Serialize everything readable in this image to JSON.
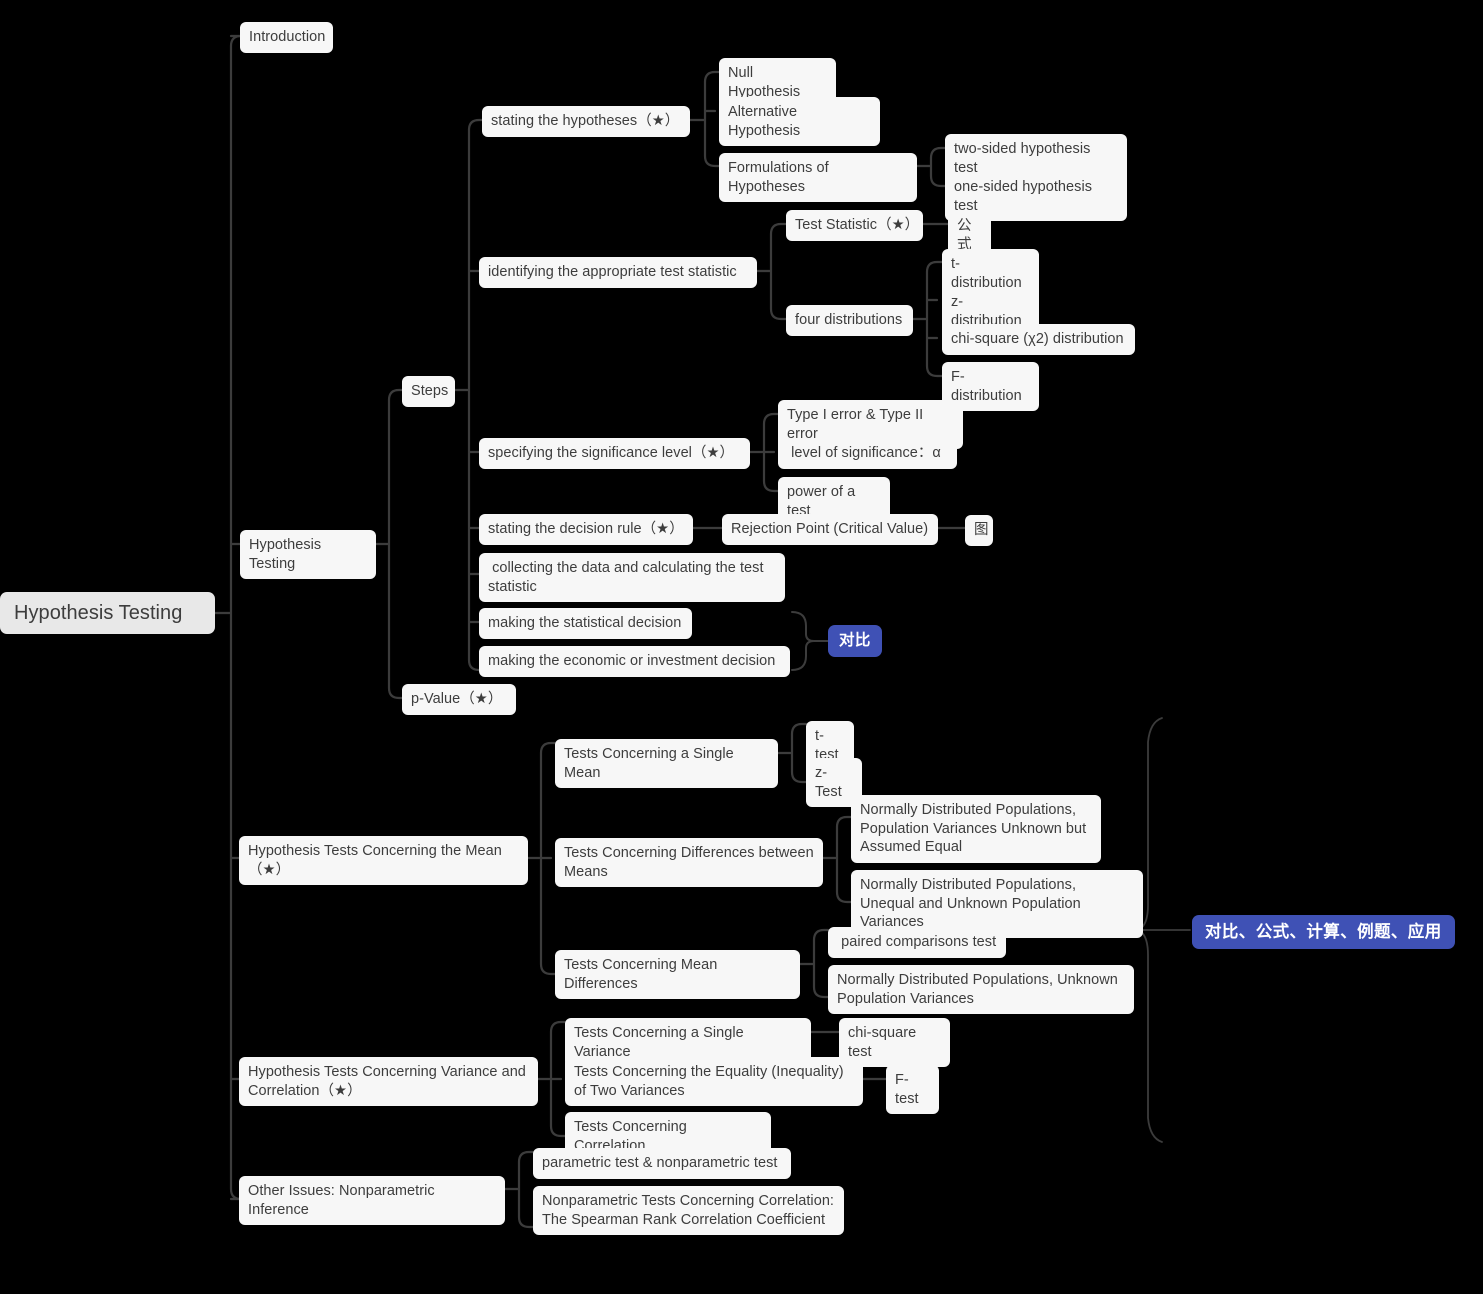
{
  "title": "Hypothesis Testing",
  "colors": {
    "background": "#000000",
    "node_fill": "#f7f7f7",
    "root_fill": "#e8e8e8",
    "node_text": "#3d3d3d",
    "link": "#3c3c3c",
    "badge_fill": "#3f51b5",
    "badge_text": "#ffffff"
  },
  "root": {
    "label": "Hypothesis Testing"
  },
  "nodes": {
    "introduction": "Introduction",
    "hypothesis_testing": "Hypothesis Testing",
    "steps": "Steps",
    "stating_hypotheses": "stating the hypotheses（★）",
    "null_hypothesis": "Null Hypothesis",
    "alternative_hypothesis": "Alternative Hypothesis",
    "formulations": "Formulations of Hypotheses",
    "two_sided": "two-sided hypothesis test",
    "one_sided": "one-sided hypothesis test",
    "identifying_test_statistic": "identifying the appropriate test statistic",
    "test_statistic": "Test Statistic（★）",
    "gongshi": "公式",
    "four_distributions": "four distributions",
    "t_distribution": "t-distribution",
    "z_distribution": "z-distribution",
    "chi_square_distribution": "chi-square (χ2) distribution",
    "f_distribution": "F-distribution",
    "specifying_significance": "specifying the significance level（★）",
    "type_errors": "Type I error & Type II error",
    "level_of_significance": " level of significance：α",
    "power_of_test": "power of a test",
    "stating_decision_rule": "stating the decision rule（★）",
    "rejection_point": "Rejection Point (Critical Value)",
    "tu": "图",
    "collecting_data": " collecting the data and calculating the test statistic",
    "statistical_decision": "making the statistical decision",
    "economic_decision": "making the economic or investment decision",
    "p_value": "p-Value（★）",
    "tests_mean": "Hypothesis Tests Concerning the Mean（★）",
    "single_mean": "Tests Concerning a Single Mean",
    "t_test": "t-test",
    "z_test": "z-Test",
    "differences_between_means": "Tests Concerning Differences between Means",
    "normal_unknown_equal": "Normally Distributed Populations, Population Variances Unknown but Assumed Equal",
    "normal_unequal_unknown": "Normally Distributed Populations, Unequal and Unknown Population Variances",
    "mean_differences": "Tests Concerning Mean Differences",
    "paired_comparisons": " paired comparisons test",
    "normal_unknown_variances": "Normally Distributed Populations, Unknown Population Variances",
    "tests_variance_correlation": "Hypothesis Tests Concerning Variance and Correlation（★）",
    "single_variance": "Tests Concerning a Single Variance",
    "chi_square_test": "chi-square test",
    "equality_two_variances": "Tests Concerning the Equality (Inequality) of Two Variances",
    "f_test": "F-test",
    "tests_correlation": "Tests Concerning Correlation",
    "other_issues": "Other Issues: Nonparametric Inference",
    "parametric_nonparametric": "parametric test & nonparametric test",
    "spearman": "Nonparametric Tests Concerning Correlation: The Spearman Rank Correlation Coefficient"
  },
  "badges": {
    "compare": "对比",
    "compare_full": "对比、公式、计算、例题、应用"
  }
}
